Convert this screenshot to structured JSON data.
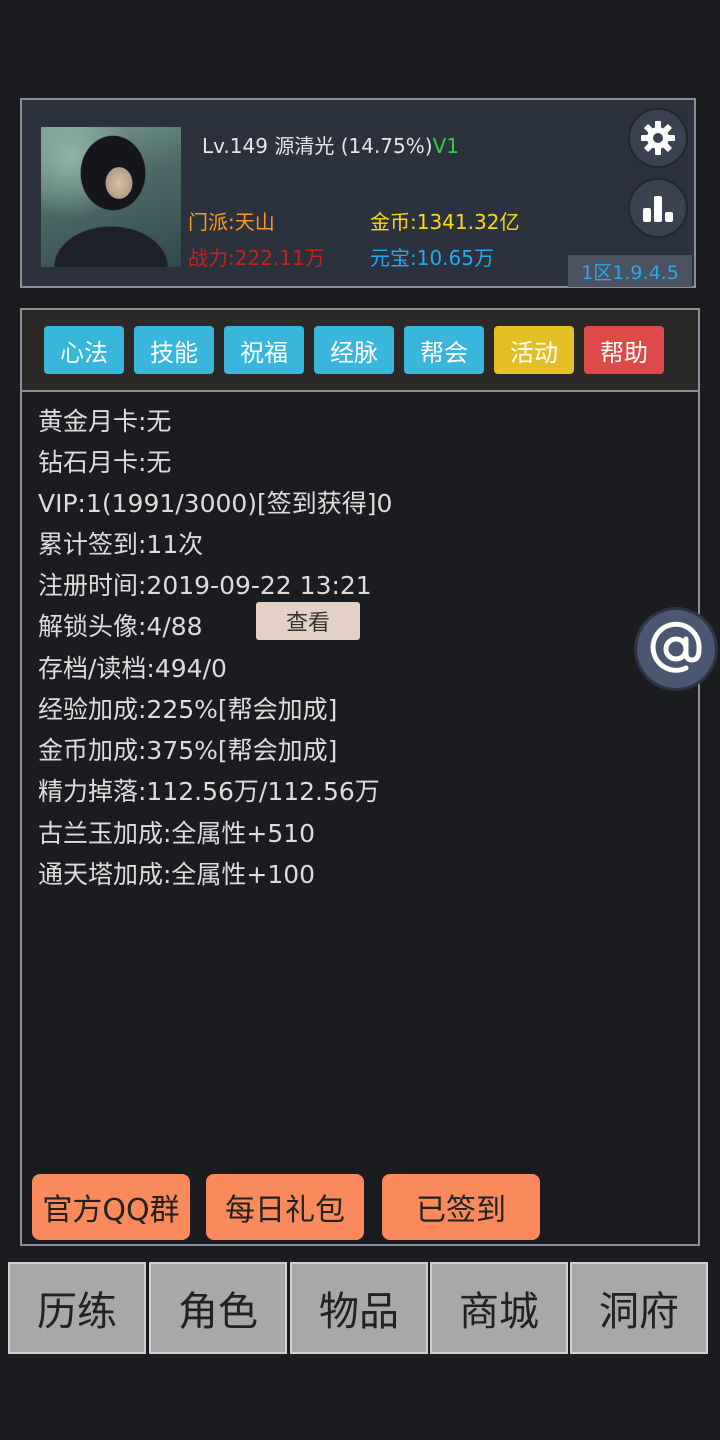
{
  "header": {
    "level": "Lv.149",
    "name": "源清光",
    "progress": "(14.75%)",
    "vip": "V1",
    "sect": "门派:天山",
    "power": "战力:222.11万",
    "gold": "金币:1341.32亿",
    "yuanbao": "元宝:10.65万",
    "server_version": "1区1.9.4.5"
  },
  "tabs": [
    {
      "label": "心法",
      "color": "#38b6db"
    },
    {
      "label": "技能",
      "color": "#38b6db"
    },
    {
      "label": "祝福",
      "color": "#38b6db"
    },
    {
      "label": "经脉",
      "color": "#38b6db"
    },
    {
      "label": "帮会",
      "color": "#38b6db"
    },
    {
      "label": "活动",
      "color": "#e4c024"
    },
    {
      "label": "帮助",
      "color": "#dc4a4a"
    }
  ],
  "info": [
    "黄金月卡:无",
    "钻石月卡:无",
    "VIP:1(1991/3000)[签到获得]0",
    "累计签到:11次",
    "注册时间:2019-09-22 13:21",
    "解锁头像:4/88",
    "存档/读档:494/0",
    "经验加成:225%[帮会加成]",
    "金币加成:375%[帮会加成]",
    "精力掉落:112.56万/112.56万",
    "古兰玉加成:全属性+510",
    "通天塔加成:全属性+100"
  ],
  "view_button": "查看",
  "action_buttons": {
    "qq_group": "官方QQ群",
    "daily_gift": "每日礼包",
    "signed_in": "已签到"
  },
  "nav": [
    "历练",
    "角色",
    "物品",
    "商城",
    "洞府"
  ],
  "icons": {
    "settings": "gear-icon",
    "ranking": "bar-chart-icon",
    "mention": "at-icon"
  }
}
